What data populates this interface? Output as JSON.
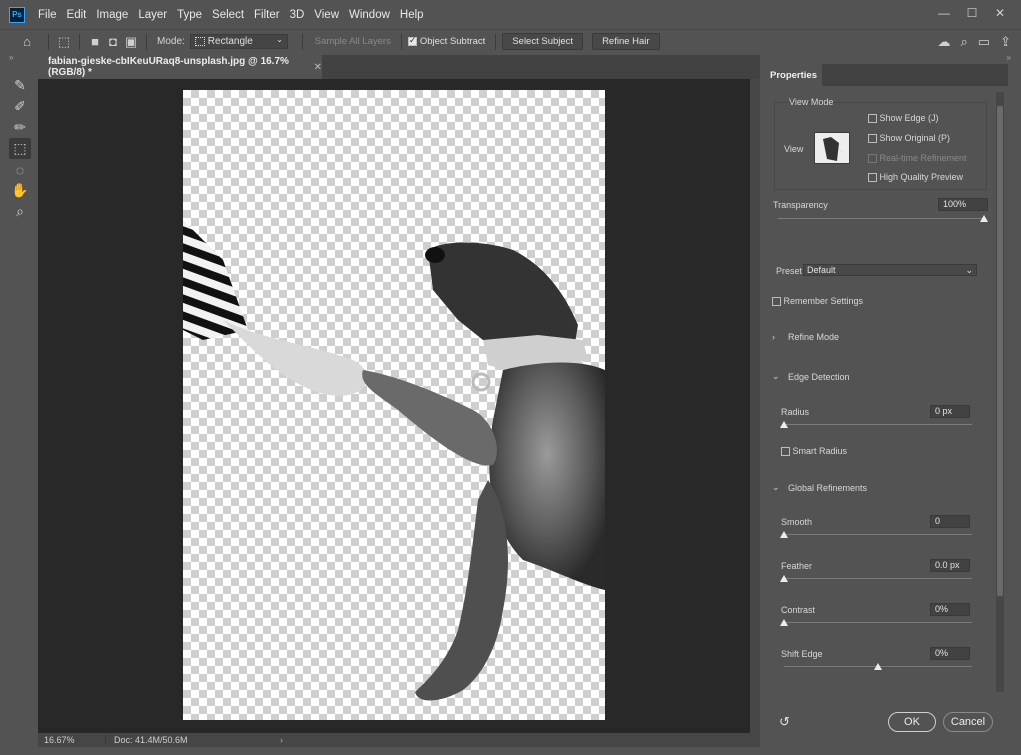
{
  "menubar": {
    "logo": "Ps",
    "items": [
      "File",
      "Edit",
      "Image",
      "Layer",
      "Type",
      "Select",
      "Filter",
      "3D",
      "View",
      "Window",
      "Help"
    ]
  },
  "options": {
    "mode_label": "Mode:",
    "mode_value": "Rectangle",
    "sample_all_layers": "Sample All Layers",
    "object_subtract": "Object Subtract",
    "select_subject": "Select Subject",
    "refine_hair": "Refine Hair"
  },
  "document": {
    "tab_title": "fabian-gieske-cbIKeuURaq8-unsplash.jpg @ 16.7% (RGB/8) *",
    "zoom": "16.67%",
    "doc_size": "Doc: 41.4M/50.6M"
  },
  "properties": {
    "tab": "Properties",
    "view_mode": "View Mode",
    "view_label": "View",
    "show_edge": "Show Edge (J)",
    "show_original": "Show Original (P)",
    "realtime_refinement": "Real-time Refinement",
    "high_quality_preview": "High Quality Preview",
    "transparency_label": "Transparency",
    "transparency_value": "100%",
    "preset_label": "Preset",
    "preset_value": "Default",
    "remember_settings": "Remember Settings",
    "refine_mode": "Refine Mode",
    "edge_detection": "Edge Detection",
    "radius_label": "Radius",
    "radius_value": "0 px",
    "smart_radius": "Smart Radius",
    "global_refinements": "Global Refinements",
    "smooth_label": "Smooth",
    "smooth_value": "0",
    "feather_label": "Feather",
    "feather_value": "0.0 px",
    "contrast_label": "Contrast",
    "contrast_value": "0%",
    "shift_edge_label": "Shift Edge",
    "shift_edge_value": "0%",
    "ok": "OK",
    "cancel": "Cancel"
  },
  "sliders": {
    "transparency": 1.0,
    "radius": 0.0,
    "smooth": 0.0,
    "feather": 0.0,
    "contrast": 0.0,
    "shift_edge": 0.5
  },
  "colors": {
    "ui_bg": "#535353",
    "canvas_bg": "#282828",
    "accent": "#31a8ff"
  }
}
